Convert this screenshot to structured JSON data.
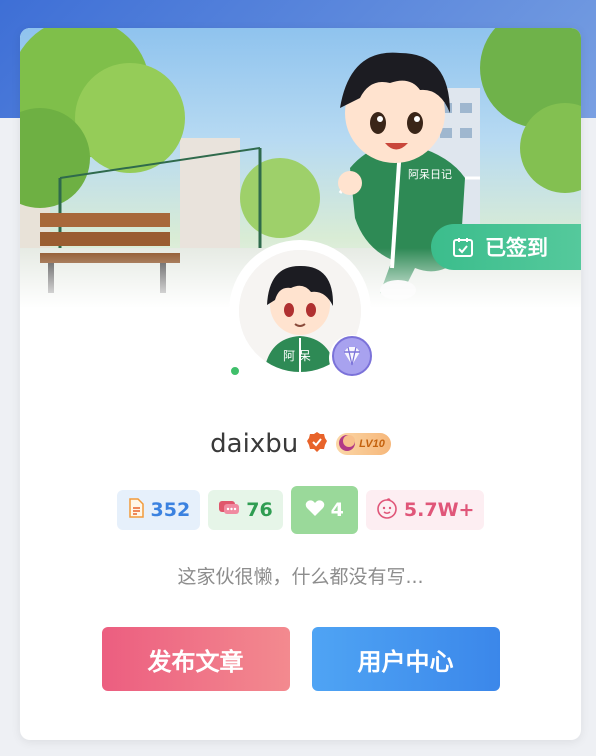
{
  "banner": {
    "checkin_label": "已签到",
    "jacket_text": "阿呆日记"
  },
  "profile": {
    "avatar_jacket_text": "阿 呆",
    "online": true,
    "username": "daixbu",
    "level_badge": "LV10"
  },
  "stats": {
    "articles": "352",
    "comments": "76",
    "likes": "4",
    "fans": "5.7W+"
  },
  "bio": "这家伙很懒，什么都没有写...",
  "buttons": {
    "publish": "发布文章",
    "user_center": "用户中心"
  },
  "colors": {
    "checkin_green": "#3bbd8c",
    "articles_blue": "#3b82e0",
    "comments_green": "#2f9d52",
    "likes_bg": "#9ad99a",
    "fans_pink": "#e05679",
    "publish_gradient": [
      "#ec5e80",
      "#f38a8f"
    ],
    "center_gradient": [
      "#4fa4f4",
      "#3b87ea"
    ]
  },
  "icons": {
    "checkin": "calendar-check-icon",
    "verified": "verified-badge-icon",
    "level": "moon-level-icon",
    "diamond": "diamond-icon",
    "articles": "document-icon",
    "comments": "chat-bubble-icon",
    "likes": "heart-icon",
    "fans": "smiley-icon"
  }
}
